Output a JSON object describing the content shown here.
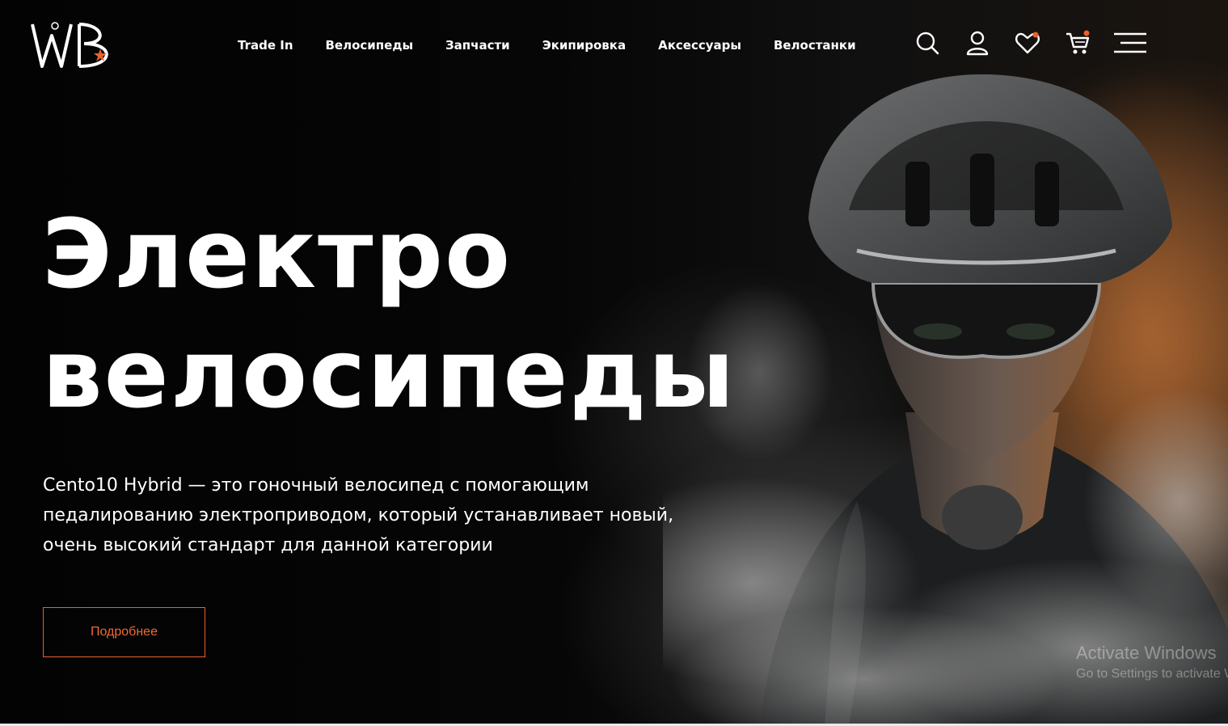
{
  "brand": {
    "logo_text": "WB",
    "accent_color": "#e8622c"
  },
  "nav": {
    "items": [
      {
        "label": "Trade In"
      },
      {
        "label": "Велосипеды"
      },
      {
        "label": "Запчасти"
      },
      {
        "label": "Экипировка"
      },
      {
        "label": "Аксессуары"
      },
      {
        "label": "Велостанки"
      }
    ]
  },
  "header_icons": [
    "search-icon",
    "user-icon",
    "heart-icon",
    "cart-icon",
    "menu-icon"
  ],
  "hero": {
    "title_line1": "Электро",
    "title_line2": "велосипеды",
    "description_line1": "Cento10 Hybrid — это гоночный велосипед с помогающим",
    "description_line2": "педалированию электроприводом, который устанавливает новый,",
    "description_line3": "очень высокий стандарт для данной категории",
    "cta_label": "Подробнее"
  },
  "watermark": {
    "line1": "Activate Windows",
    "line2": "Go to Settings to activate Windows."
  }
}
